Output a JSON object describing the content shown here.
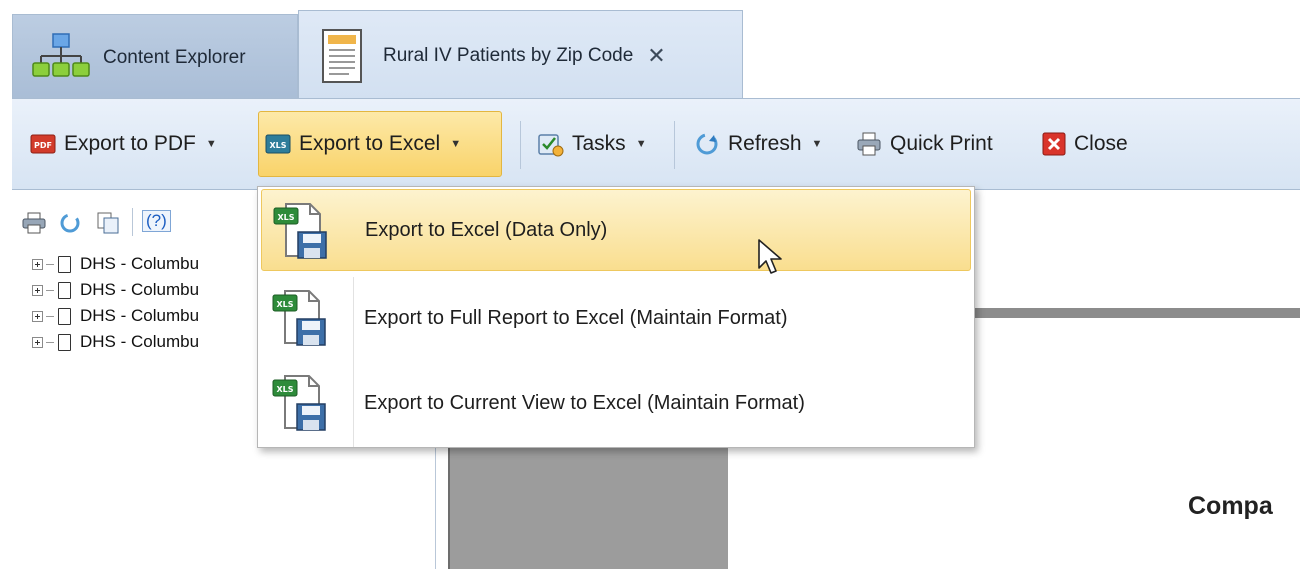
{
  "tabs": [
    {
      "label": "Content Explorer",
      "icon": "org-chart-icon"
    },
    {
      "label": "Rural IV Patients by Zip Code",
      "icon": "report-document-icon",
      "close": "✕"
    }
  ],
  "toolbar": {
    "export_pdf": "Export to PDF",
    "export_excel": "Export to Excel",
    "tasks": "Tasks",
    "refresh": "Refresh",
    "quick_print": "Quick Print",
    "close": "Close"
  },
  "export_menu": {
    "items": [
      {
        "label": "Export to Excel (Data Only)",
        "icon": "xls-save-icon",
        "highlighted": true
      },
      {
        "label": "Export to Full Report to Excel (Maintain Format)",
        "icon": "xls-save-icon",
        "highlighted": false
      },
      {
        "label": "Export to Current View to Excel (Maintain Format)",
        "icon": "xls-save-icon",
        "highlighted": false
      }
    ]
  },
  "tree": {
    "toolbar_icons": [
      "print-icon",
      "refresh-icon",
      "copy-icon",
      "help-icon"
    ],
    "help_label": "(?)",
    "items": [
      {
        "label": "DHS - Columbu"
      },
      {
        "label": "DHS - Columbu"
      },
      {
        "label": "DHS - Columbu"
      },
      {
        "label": "DHS - Columbu"
      }
    ]
  },
  "report": {
    "title_partial": "Compa"
  },
  "colors": {
    "tab_active": "#d2e0f1",
    "tab_inactive": "#a9bdd6",
    "ribbon": "#dfe9f5",
    "highlight": "#f9de8f",
    "excel_green": "#2e8b3a"
  }
}
